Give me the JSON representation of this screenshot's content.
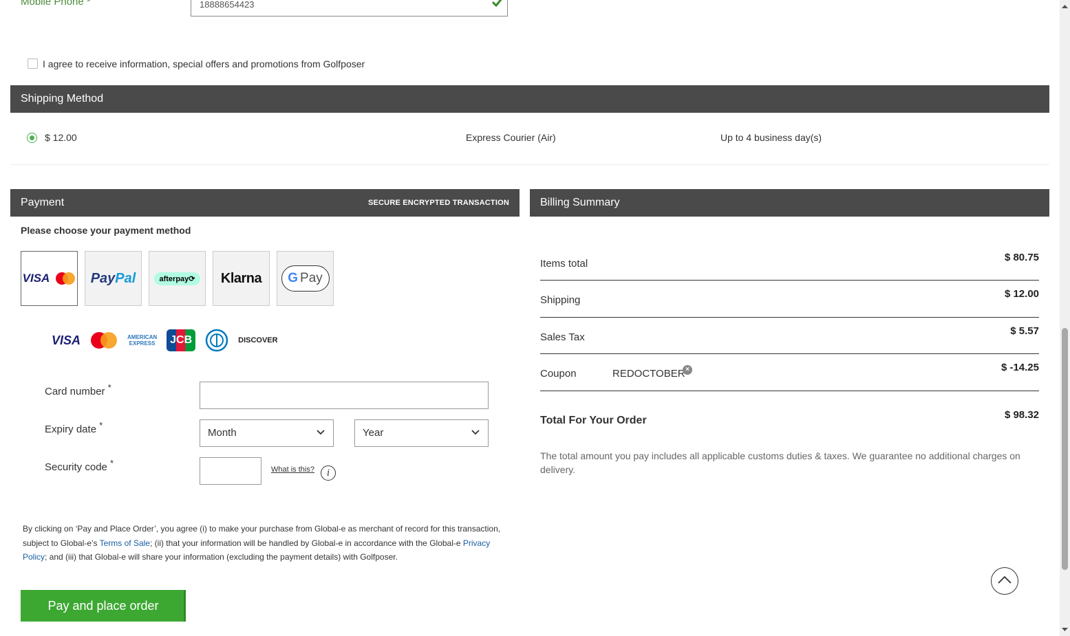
{
  "contact": {
    "mobile_label": "Mobile Phone *",
    "mobile_value": "18888654423",
    "agree_text": "I agree to receive information, special offers and promotions from Golfposer"
  },
  "shipping": {
    "title": "Shipping Method",
    "options": [
      {
        "price": "$ 12.00",
        "method": "Express Courier (Air)",
        "eta": "Up to 4 business day(s)",
        "selected": true
      }
    ]
  },
  "payment": {
    "title": "Payment",
    "secure_label": "SECURE ENCRYPTED TRANSACTION",
    "choose_label": "Please choose your payment method",
    "methods": [
      "card-visa-mastercard",
      "paypal",
      "afterpay",
      "klarna",
      "google-pay"
    ],
    "method_labels": {
      "visa": "VISA",
      "paypal_a": "Pay",
      "paypal_b": "Pal",
      "afterpay": "afterpay⟳",
      "klarna": "Klarna",
      "gpay": "Pay"
    },
    "card_brands": {
      "visa": "VISA",
      "amex_line1": "AMERICAN",
      "amex_line2": "EXPRESS",
      "jcb": "JCB",
      "discover": "DISCOVER"
    },
    "card_number_label": "Card number",
    "expiry_label": "Expiry date",
    "month_placeholder": "Month",
    "year_placeholder": "Year",
    "security_label": "Security code",
    "required_mark": "*",
    "what_is_this": "What is this?",
    "legal": {
      "part1": "By clicking on ‘Pay and Place Order’, you agree (i) to make your purchase from Global-e as merchant of record for this transaction, subject to Global-e’s ",
      "terms_link": "Terms of Sale",
      "part2": "; (ii) that your information will be handled by Global-e in accordance with the Global-e ",
      "privacy_link": "Privacy Policy",
      "part3": "; and (iii) that Global-e will share your information (excluding the payment details) with Golfposer."
    },
    "pay_button": "Pay and place order"
  },
  "billing": {
    "title": "Billing Summary",
    "items_total_label": "Items total",
    "items_total_value": "$ 80.75",
    "shipping_label": "Shipping",
    "shipping_value": "$ 12.00",
    "sales_tax_label": "Sales Tax",
    "sales_tax_value": "$ 5.57",
    "coupon_label": "Coupon",
    "coupon_code": "REDOCTOBER",
    "coupon_value": "$ -14.25",
    "total_label": "Total For Your Order",
    "total_value": "$ 98.32",
    "note": "The total amount you pay includes all applicable customs duties & taxes. We guarantee no additional charges on delivery."
  },
  "colors": {
    "header_bar": "#4a4a4a",
    "accent_green": "#3ca832",
    "link_blue": "#1a5fa0"
  }
}
